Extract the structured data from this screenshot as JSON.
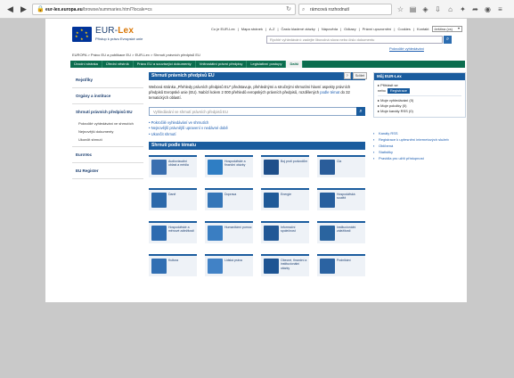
{
  "browser": {
    "url_host": "eur-lex.europa.eu",
    "url_rest": "/browse/summaries.html?locale=cs",
    "search_value": "rámcová rozhodnutí",
    "icons": [
      "back-icon",
      "forward-icon",
      "lock-icon",
      "reload-icon",
      "search-icon",
      "star-icon",
      "reading-list-icon",
      "shield-icon",
      "download-icon",
      "home-icon",
      "extension-icon",
      "share-icon",
      "menu-icon"
    ]
  },
  "header": {
    "brand_prefix": "EUR-",
    "brand_suffix": "Lex",
    "tagline": "Přístup k právu Evropské unie",
    "top_links": [
      "Co je EUR-Lex",
      "Mapa stránek",
      "A-Z",
      "Často kladené otázky",
      "Nápověda",
      "Odkazy",
      "Právní upozornění",
      "Cookies",
      "Kontakt"
    ],
    "language": "čeština (cs)",
    "search_placeholder": "Rychlé vyhledávání: zadejte libovolná slova nebo číslo dokumentu",
    "advanced_link": "Pokročilé vyhledávání"
  },
  "breadcrumb": "EUROPA > Právo EU a publikace EU > EUR-Lex > Shrnutí právních předpisů EU",
  "tabs": [
    {
      "label": "Úvodní stránka"
    },
    {
      "label": "Úřední věstník"
    },
    {
      "label": "Právo EU a související dokumenty"
    },
    {
      "label": "Vnitrostátní právní předpisy"
    },
    {
      "label": "Legislativní postupy"
    },
    {
      "label": "Další"
    }
  ],
  "left_nav": {
    "items": [
      "Rejstříky",
      "Orgány a instituce",
      "Shrnutí právních předpisů EU",
      "EuroVoc",
      "EU Register"
    ],
    "sub_items": [
      "Pokročilé vyhledávání ve shrnutích",
      "Nejnovější dokumenty",
      "Ukončit shrnutí"
    ]
  },
  "main": {
    "title": "Shrnutí právních předpisů EU",
    "controls": [
      "?",
      "Sdílet"
    ],
    "intro_parts": [
      "Webová stránka „Přehledy právních předpisů EU\" představuje, přehlednými a stručnými shrnutími hlavní aspekty právních předpisů Evropské unie (EU). Nabízí kolem 2 000 přehledů evropských právních předpisů, rozdělených ",
      "podle témat",
      " do 32 tematických oblastí."
    ],
    "search_placeholder": "Vyhledávání ve shrnutí právních předpisů EU",
    "links": [
      "Pokročilé vyhledávání ve shrnutích",
      "Nejnovější právnější upravení v nedávné době",
      "Ukončit shrnutí"
    ],
    "topics_title": "Shrnutí podle tématu",
    "topics": [
      {
        "label": "Audiovizuální oblast a média",
        "color": "#3a6fb0",
        "icon": "film-icon"
      },
      {
        "label": "Hospodářské a finanční otázky",
        "color": "#2f7ec4",
        "icon": "euro-coin-icon"
      },
      {
        "label": "Boj proti podvodům",
        "color": "#1f4f8a",
        "icon": "magnifier-icon"
      },
      {
        "label": "Cla",
        "color": "#2a5d9a",
        "icon": "customs-icon"
      },
      {
        "label": "Daně",
        "color": "#2c69aa",
        "icon": "tax-icon"
      },
      {
        "label": "Doprava",
        "color": "#3576b8",
        "icon": "transport-icon"
      },
      {
        "label": "Energie",
        "color": "#1f5a98",
        "icon": "energy-icon"
      },
      {
        "label": "Hospodářská soutěž",
        "color": "#275f9e",
        "icon": "competition-icon"
      },
      {
        "label": "Hospodářské a měnové záležitosti",
        "color": "#2d6bb0",
        "icon": "money-icon"
      },
      {
        "label": "Humanitární pomoc",
        "color": "#3a7ec2",
        "icon": "aid-icon"
      },
      {
        "label": "Informační společnost",
        "color": "#215896",
        "icon": "information-society-icon"
      },
      {
        "label": "Institucionální záležitosti",
        "color": "#2a649f",
        "icon": "institutions-icon"
      },
      {
        "label": "Kultura",
        "color": "#316fb3",
        "icon": "culture-icon"
      },
      {
        "label": "Lidská práva",
        "color": "#4182c6",
        "icon": "human-rights-icon"
      },
      {
        "label": "Obecné, finanční a institucionální otázky",
        "color": "#1d5493",
        "icon": "general-affairs-icon"
      },
      {
        "label": "Podnikání",
        "color": "#2b63a2",
        "icon": "enterprise-icon"
      }
    ]
  },
  "right_panel": {
    "title": "Můj EUR-Lex",
    "login": "Přihlásit se",
    "or": "nebo",
    "register": "Registrace",
    "items": [
      "Moje vyhledávání (0)",
      "Moje položky (0)",
      "Moje kanály RSS (0)"
    ],
    "links": [
      "Kanály RSS",
      "Registrace k upřesnění internetových služeb",
      "Oblíbená",
      "Statistiky",
      "Pravidla pro užití přístupnost"
    ]
  }
}
